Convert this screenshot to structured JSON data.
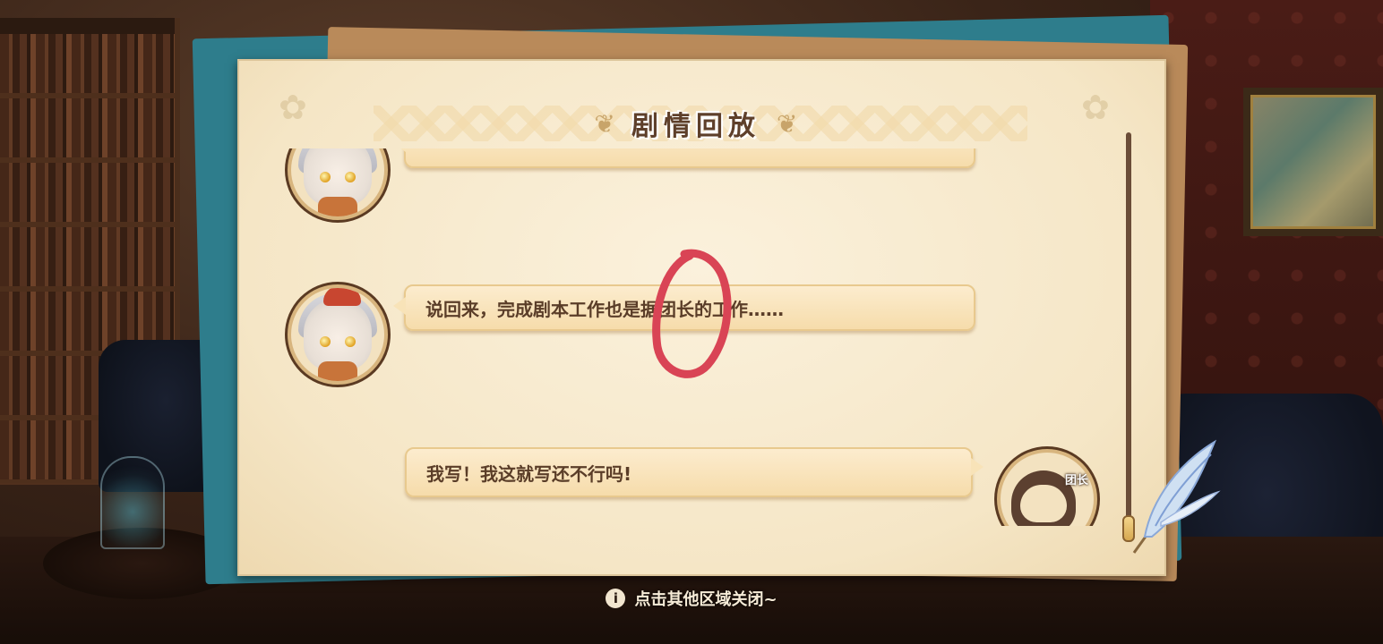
{
  "panel": {
    "title": "剧情回放"
  },
  "messages": [
    {
      "speaker_side": "left",
      "text": ""
    },
    {
      "speaker_side": "left",
      "text": "说回来，完成剧本工作也是据团长的工作……"
    },
    {
      "speaker_side": "right",
      "text": "我写！我这就写还不行吗!"
    }
  ],
  "player": {
    "tag": "团长"
  },
  "footer": {
    "hint_text": "点击其他区域关闭~"
  },
  "icons": {
    "info": "info-icon",
    "quill": "quill-icon",
    "flourish": "flourish-ornament"
  },
  "colors": {
    "annotation": "#d94455",
    "bubble": "#f8e3b8",
    "title": "#5e3f2a",
    "teal_paper": "#2e7d8c"
  }
}
